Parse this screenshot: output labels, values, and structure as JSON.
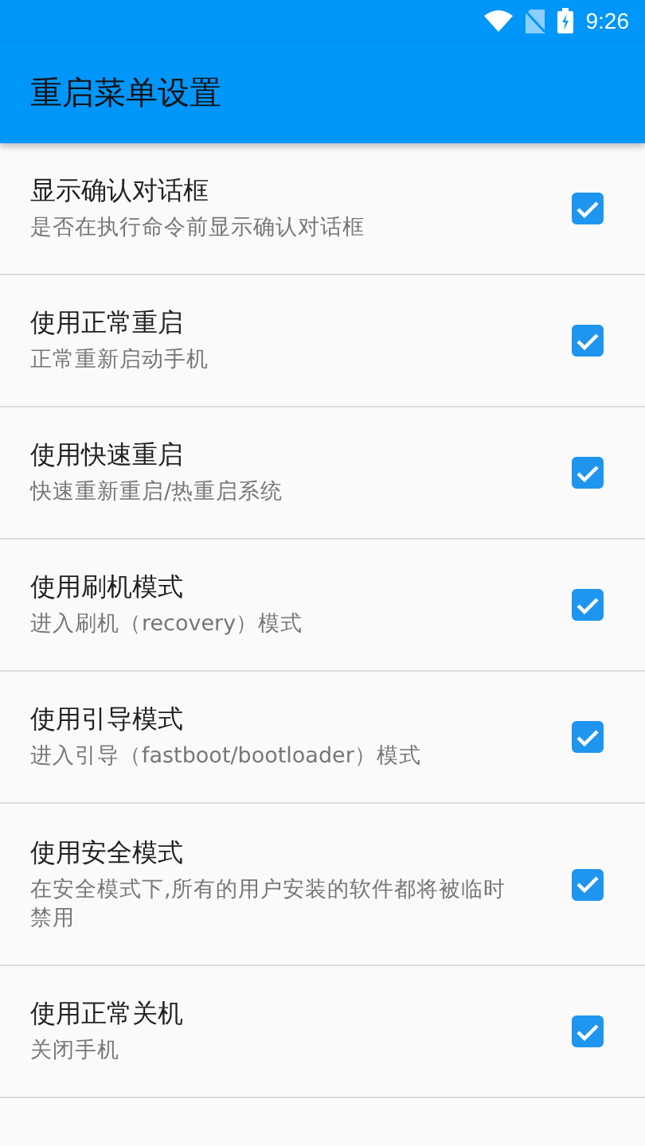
{
  "status_bar": {
    "time": "9:26"
  },
  "app_bar": {
    "title": "重启菜单设置"
  },
  "settings": [
    {
      "title": "显示确认对话框",
      "summary": "是否在执行命令前显示确认对话框",
      "checked": true
    },
    {
      "title": "使用正常重启",
      "summary": "正常重新启动手机",
      "checked": true
    },
    {
      "title": "使用快速重启",
      "summary": "快速重新重启/热重启系统",
      "checked": true
    },
    {
      "title": "使用刷机模式",
      "summary": "进入刷机（recovery）模式",
      "checked": true
    },
    {
      "title": "使用引导模式",
      "summary": "进入引导（fastboot/bootloader）模式",
      "checked": true
    },
    {
      "title": "使用安全模式",
      "summary": "在安全模式下,所有的用户安装的软件都将被临时禁用",
      "checked": true
    },
    {
      "title": "使用正常关机",
      "summary": "关闭手机",
      "checked": true
    }
  ]
}
